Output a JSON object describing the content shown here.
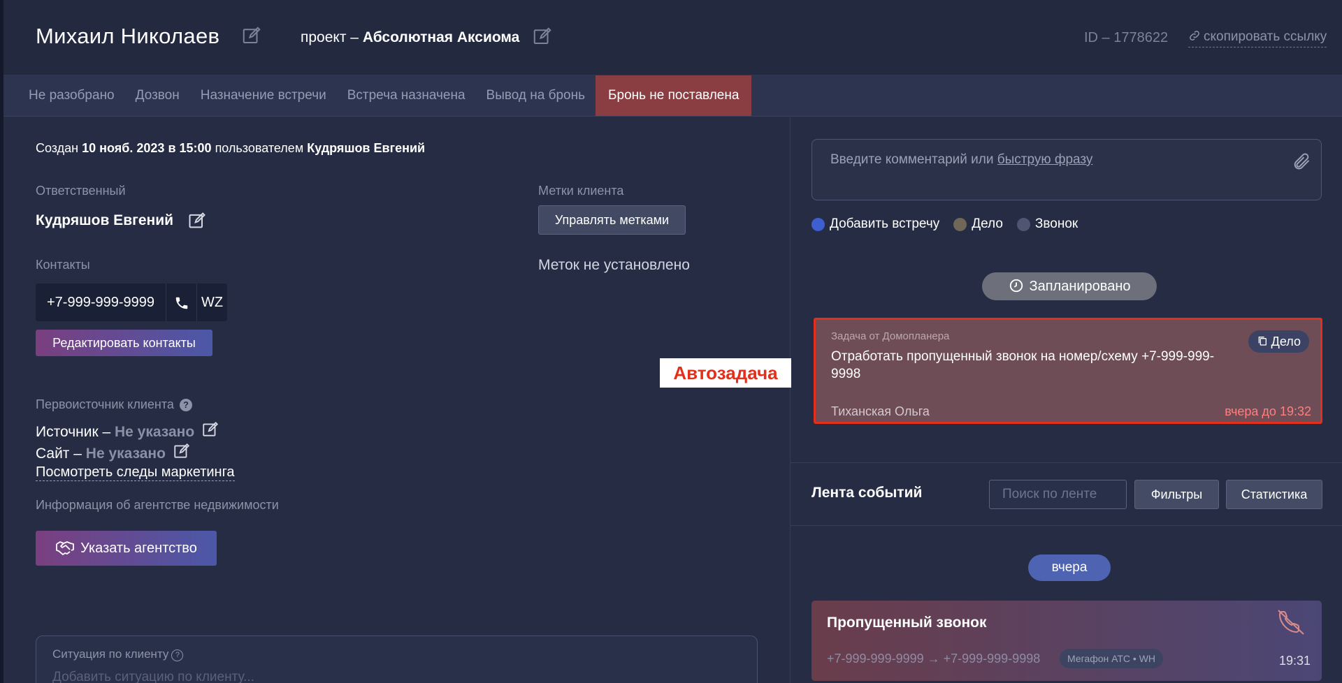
{
  "header": {
    "client_name": "Михаил Николаев",
    "project_prefix": "проект – ",
    "project_name": "Абсолютная Аксиома",
    "record_id": "ID – 1778622",
    "copy_link": "скопировать ссылку"
  },
  "stages": [
    {
      "label": "Не разобрано",
      "active": false
    },
    {
      "label": "Дозвон",
      "active": false
    },
    {
      "label": "Назначение встречи",
      "active": false
    },
    {
      "label": "Встреча назначена",
      "active": false
    },
    {
      "label": "Вывод на бронь",
      "active": false
    },
    {
      "label": "Бронь не поставлена",
      "active": true
    }
  ],
  "left": {
    "created_prefix": "Создан ",
    "created_date": "10 нояб. 2023 в 15:00",
    "created_mid": " пользователем ",
    "created_user": "Кудряшов Евгений",
    "responsible_label": "Ответственный",
    "responsible_name": "Кудряшов Евгений",
    "contacts_label": "Контакты",
    "phone": "+7-999-999-9999",
    "wz_label": "WZ",
    "edit_contacts_button": "Редактировать контакты",
    "source_origin_label": "Первоисточник клиента",
    "source_label": "Источник – ",
    "source_value": "Не указано",
    "site_label": "Сайт – ",
    "site_value": "Не указано",
    "marketing_link": "Посмотреть следы маркетинга",
    "agency_info_label": "Информация об агентстве недвижимости",
    "agency_button": "Указать агентство",
    "tags_label": "Метки клиента",
    "tags_button": "Управлять метками",
    "no_tags": "Меток не установлено",
    "situation_label": "Ситуация по клиенту",
    "situation_placeholder": "Добавить ситуацию по клиенту..."
  },
  "annotation": {
    "autotask": "Автозадача"
  },
  "right": {
    "comment_placeholder_prefix": "Введите комментарий или ",
    "comment_placeholder_link": "быструю фразу",
    "radios": [
      {
        "label": "Добавить встречу",
        "color": "#3f5ecf"
      },
      {
        "label": "Дело",
        "color": "#6f6757"
      },
      {
        "label": "Звонок",
        "color": "#4f5672"
      }
    ],
    "planned_pill": "Запланировано",
    "task": {
      "from": "Задача от Домопланера",
      "text": "Отработать пропущенный звонок на номер/схему +7-999-999-9998",
      "assignee": "Тиханская Ольга",
      "due": "вчера до 19:32",
      "kind": "Дело"
    },
    "feed": {
      "title": "Лента событий",
      "search_placeholder": "Поиск по ленте",
      "filters_button": "Фильтры",
      "stats_button": "Статистика",
      "day_pill": "вчера"
    },
    "missed_call": {
      "title": "Пропущенный звонок",
      "route": "+7-999-999-9999 → +7-999-999-9998",
      "badge": "Мегафон АТС • WH",
      "time": "19:31"
    }
  },
  "colors": {
    "background": "#252c44",
    "active_stage": "#8a3e42",
    "highlight_border": "#e3301d",
    "due_text": "#ff7f7f"
  }
}
